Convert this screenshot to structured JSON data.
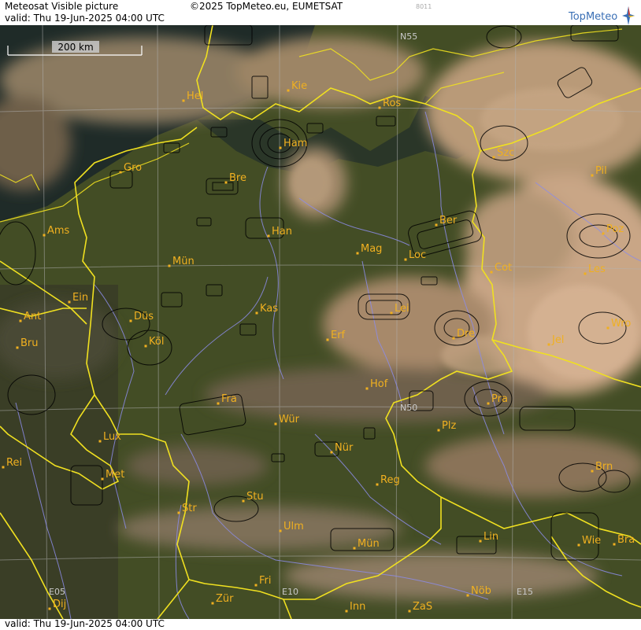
{
  "header": {
    "title": "Meteosat Visible picture",
    "valid": "valid:  Thu  19-Jun-2025  04:00 UTC",
    "copyright": "©2025 TopMeteo.eu, EUMETSAT",
    "code": "8011",
    "logo_text": "TopMeteo"
  },
  "footer": {
    "valid": "valid:  Thu  19-Jun-2025  04:00 UTC"
  },
  "scale": {
    "label": "200 km"
  },
  "grid_labels": [
    "N55",
    "N50",
    "E05",
    "E10",
    "E15"
  ],
  "cities": [
    "Hel",
    "Kie",
    "Ros",
    "Ham",
    "Gro",
    "Bre",
    "Szc",
    "Pil",
    "Ams",
    "Han",
    "Ber",
    "Poz",
    "Mag",
    "Loc",
    "Mün",
    "Cot",
    "Les",
    "Ein",
    "Kas",
    "Lei",
    "Ant",
    "Düs",
    "Wro",
    "Dre",
    "Erf",
    "Bru",
    "Köl",
    "Jel",
    "Hof",
    "Fra",
    "Pra",
    "Wür",
    "Plz",
    "Lux",
    "Nür",
    "Rei",
    "Met",
    "Reg",
    "Brn",
    "Stu",
    "Str",
    "Ulm",
    "Lin",
    "Mün",
    "Wie",
    "Bra",
    "Fri",
    "Dij",
    "Zür",
    "Inn",
    "ZaS",
    "Nöb"
  ],
  "colors": {
    "city": "#f0b020",
    "border": "#f0e020",
    "river": "#8c8ce8",
    "grid": "#b4b4b4"
  }
}
